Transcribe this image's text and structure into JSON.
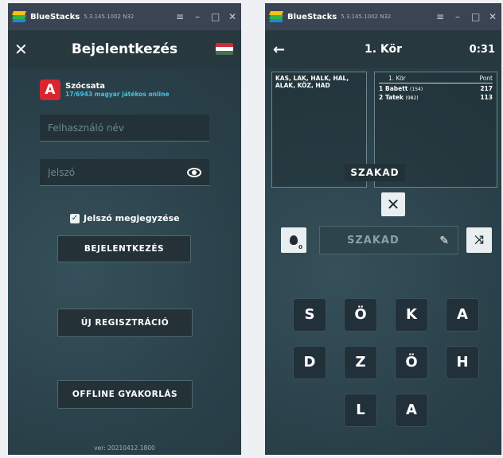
{
  "emulator": {
    "name": "BlueStacks",
    "version": "5.3.145.1002 N32",
    "controls": [
      "menu-icon",
      "minimize-icon",
      "maximize-icon",
      "close-icon"
    ]
  },
  "login": {
    "title": "Bejelentkezés",
    "close_icon": "close-icon",
    "flag_icon": "hungarian-flag-icon",
    "flag_colors": [
      "#ce2939",
      "#ffffff",
      "#477050"
    ],
    "app_icon_letter": "A",
    "app_name": "Szócsata",
    "online_text": "17/6943 magyar játékos online",
    "username_placeholder": "Felhasználó név",
    "password_placeholder": "Jelszó",
    "remember_label": "Jelszó megjegyzése",
    "remember_checked": true,
    "login_button": "BEJELENTKEZÉS",
    "register_button": "ÚJ REGISZTRÁCIÓ",
    "offline_button": "OFFLINE GYAKORLÁS",
    "version_text": "ver: 20210412.1800"
  },
  "game": {
    "back_icon": "back-arrow-icon",
    "title": "1. Kör",
    "timer": "0:31",
    "found_words": "KAS, LAK, HALK, HAL, ALAK, KÖZ, HAD",
    "scoreboard": {
      "round_header": "1. Kör",
      "points_header": "Pont",
      "players": [
        {
          "rank": "1",
          "name": "Babett",
          "rating": "(154)",
          "points": "217"
        },
        {
          "rank": "2",
          "name": "Tatek",
          "rating": "(982)",
          "points": "113"
        }
      ]
    },
    "current_word": "SZAKAD",
    "clear_label": "✕",
    "hint_count": "0",
    "input_word": "SZAKAD",
    "shuffle_label": "⤨",
    "letters": [
      [
        "S",
        "Ö",
        "K",
        "A"
      ],
      [
        "D",
        "Z",
        "Ö",
        "H"
      ],
      [
        "L",
        "A"
      ]
    ]
  },
  "colors": {
    "background": "#2a4049",
    "appbar": "#27393f",
    "accent_online": "#3fc5ea",
    "app_icon": "#d8262f"
  }
}
